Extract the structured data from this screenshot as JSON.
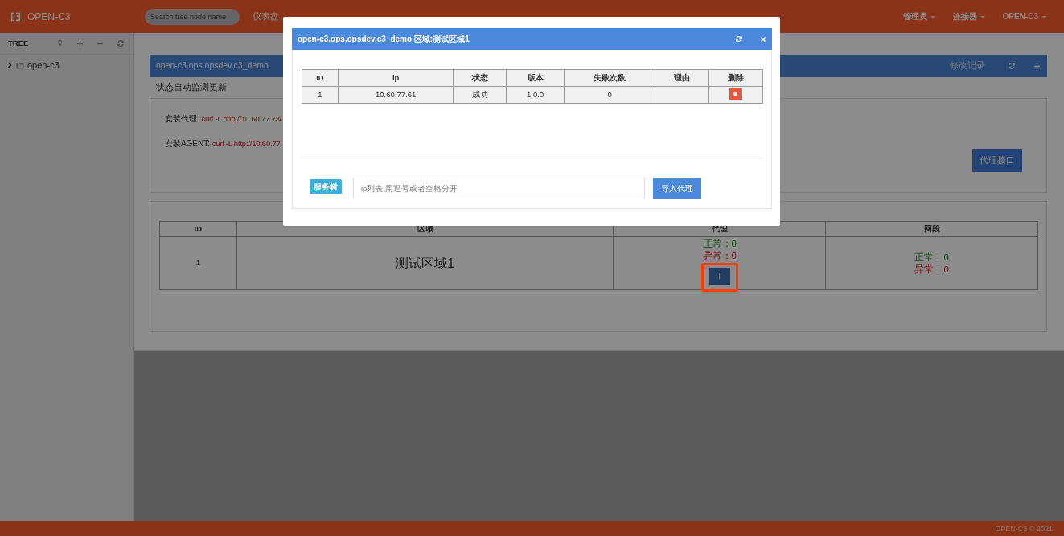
{
  "navbar": {
    "brand": "OPEN-C3",
    "search": {
      "placeholder": "Search tree node name"
    },
    "menu": [
      {
        "label": "仪表盘",
        "dropdown": false
      }
    ],
    "right_menu": [
      {
        "label": "管理员",
        "dropdown": true
      },
      {
        "label": "连接器",
        "dropdown": true
      },
      {
        "label": "OPEN-C3",
        "dropdown": true
      }
    ]
  },
  "sidebar": {
    "title": "TREE",
    "tree": [
      {
        "label": "open-c3",
        "expanded": false
      }
    ]
  },
  "main": {
    "header": {
      "title": "open-c3.ops.opsdev.c3_demo",
      "link": "修改记录"
    },
    "subtitle": "状态自动监测更新",
    "install": [
      {
        "label": "安装代理:",
        "command": "curl -L http://10.60.77.73/"
      },
      {
        "label": "安装AGENT:",
        "command": "curl -L http://10.60.77."
      }
    ],
    "api_button": "代理接口",
    "regions": {
      "columns": [
        "ID",
        "区域",
        "代理",
        "网段"
      ],
      "rows": [
        {
          "id": "1",
          "name": "测试区域1",
          "agent": [
            {
              "text": "正常：0",
              "kind": "ok"
            },
            {
              "text": "异常：0",
              "kind": "error"
            }
          ],
          "add_button": "+",
          "add_highlighted": true,
          "segment": [
            {
              "text": "正常：0",
              "kind": "ok"
            },
            {
              "text": "异常：0",
              "kind": "error"
            }
          ]
        }
      ]
    }
  },
  "modal": {
    "title": "open-c3.ops.opsdev.c3_demo 区域:测试区域1",
    "columns": [
      "ID",
      "ip",
      "状态",
      "版本",
      "失败次数",
      "理由",
      "删除"
    ],
    "rows": [
      {
        "id": "1",
        "ip": "10.60.77.61",
        "status": "成功",
        "version": "1.0.0",
        "failures": "0"
      }
    ],
    "badge": "服务树",
    "input": {
      "placeholder": "ip列表,用逗号或者空格分开"
    },
    "import_button": "导入代理"
  },
  "footer": "OPEN-C3 © 2021"
}
